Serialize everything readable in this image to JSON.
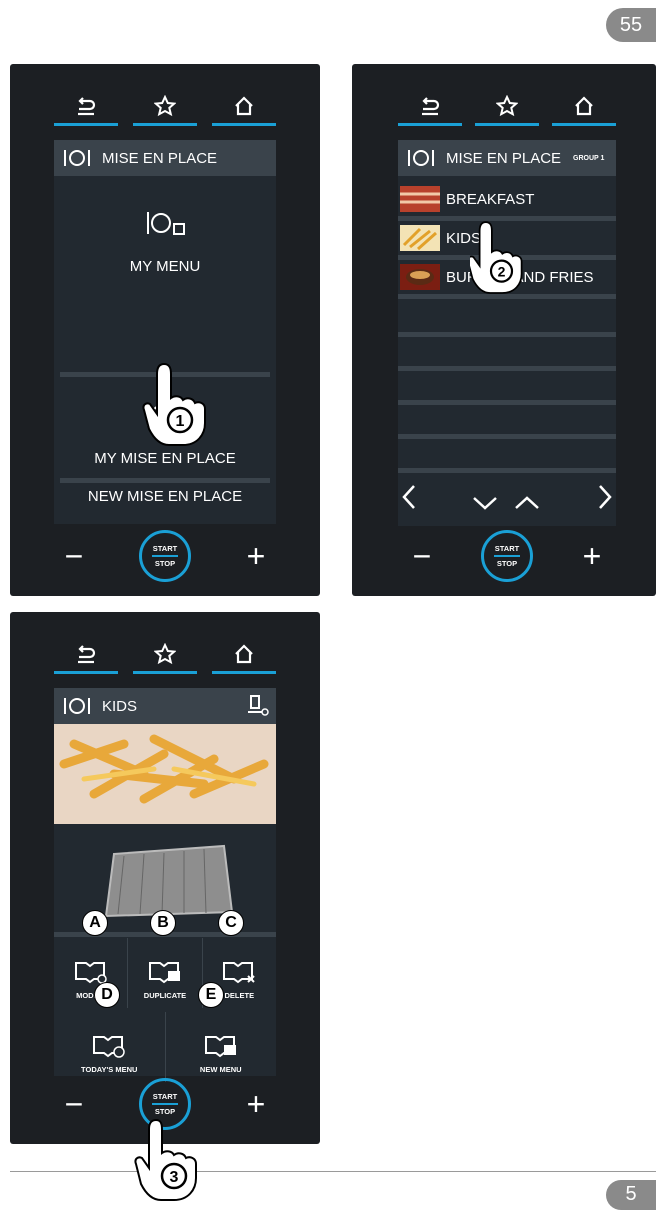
{
  "page_number_top": "55",
  "page_number_bottom": "5",
  "panel1": {
    "title": "MISE EN PLACE",
    "items": [
      "MY MENU",
      "MY MISE EN PLACE",
      "NEW MISE EN PLACE"
    ],
    "start_label": "START",
    "stop_label": "STOP",
    "step": "1"
  },
  "panel2": {
    "title": "MISE EN PLACE",
    "group": "GROUP 1",
    "rows": [
      "BREAKFAST",
      "KIDS",
      "BURGER AND FRIES"
    ],
    "start_label": "START",
    "stop_label": "STOP",
    "step": "2"
  },
  "panel3": {
    "title": "KIDS",
    "actions_row1": [
      "MODIFY",
      "DUPLICATE",
      "DELETE"
    ],
    "actions_row2": [
      "TODAY'S MENU",
      "NEW MENU"
    ],
    "badges": [
      "A",
      "B",
      "C",
      "D",
      "E"
    ],
    "start_label": "START",
    "stop_label": "STOP",
    "step": "3"
  },
  "icons": [
    "back-icon",
    "star-icon",
    "home-icon",
    "plate-icon",
    "minus-icon",
    "plus-icon"
  ],
  "colors": {
    "accent": "#1aa0d6",
    "screen": "#222930",
    "bezel": "#1c1f23"
  }
}
